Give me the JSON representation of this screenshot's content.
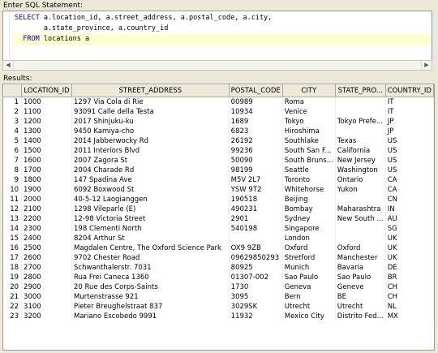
{
  "editor": {
    "label": "Enter SQL Statement:",
    "lines": [
      {
        "kw": "SELECT",
        "text": " a.location_id, a.street_address, a.postal_code, a.city,"
      },
      {
        "kw": "",
        "text": "       a.state_province, a.country_id"
      },
      {
        "kw": "  FROM",
        "text": " locations a"
      }
    ]
  },
  "results": {
    "label": "Results:",
    "columns": [
      "",
      "LOCATION_ID",
      "STREET_ADDRESS",
      "POSTAL_CODE",
      "CITY",
      "STATE_PRO...",
      "COUNTRY_ID"
    ],
    "rows": [
      [
        "1",
        "1000",
        "1297 Via Cola di Rie",
        "00989",
        "Roma",
        "",
        "IT"
      ],
      [
        "2",
        "1100",
        "93091 Calle della Testa",
        "10934",
        "Venice",
        "",
        "IT"
      ],
      [
        "3",
        "1200",
        "2017 Shinjuku-ku",
        "1689",
        "Tokyo",
        "Tokyo Prefe...",
        "JP"
      ],
      [
        "4",
        "1300",
        "9450 Kamiya-cho",
        "6823",
        "Hiroshima",
        "",
        "JP"
      ],
      [
        "5",
        "1400",
        "2014 Jabberwocky Rd",
        "26192",
        "Southlake",
        "Texas",
        "US"
      ],
      [
        "6",
        "1500",
        "2011 Interiors Blvd",
        "99236",
        "South San F...",
        "California",
        "US"
      ],
      [
        "7",
        "1600",
        "2007 Zagora St",
        "50090",
        "South Bruns...",
        "New Jersey",
        "US"
      ],
      [
        "8",
        "1700",
        "2004 Charade Rd",
        "98199",
        "Seattle",
        "Washington",
        "US"
      ],
      [
        "9",
        "1800",
        "147 Spadina Ave",
        "M5V 2L7",
        "Toronto",
        "Ontario",
        "CA"
      ],
      [
        "10",
        "1900",
        "6092 Boxwood St",
        "YSW 9T2",
        "Whitehorse",
        "Yukon",
        "CA"
      ],
      [
        "11",
        "2000",
        "40-5-12 Laogianggen",
        "190518",
        "Beijing",
        "",
        "CN"
      ],
      [
        "12",
        "2100",
        "1298 Vileparle (E)",
        "490231",
        "Bombay",
        "Maharashtra",
        "IN"
      ],
      [
        "13",
        "2200",
        "12-98 Victoria Street",
        "2901",
        "Sydney",
        "New South ...",
        "AU"
      ],
      [
        "14",
        "2300",
        "198 Clementi North",
        "540198",
        "Singapore",
        "",
        "SG"
      ],
      [
        "15",
        "2400",
        "8204 Arthur St",
        "",
        "London",
        "",
        "UK"
      ],
      [
        "16",
        "2500",
        "Magdalen Centre, The Oxford Science Park",
        "OX9 9ZB",
        "Oxford",
        "Oxford",
        "UK"
      ],
      [
        "17",
        "2600",
        "9702 Chester Road",
        "09629850293",
        "Stretford",
        "Manchester",
        "UK"
      ],
      [
        "18",
        "2700",
        "Schwanthalerstr. 7031",
        "80925",
        "Munich",
        "Bavaria",
        "DE"
      ],
      [
        "19",
        "2800",
        "Rua Frei Caneca 1360",
        "01307-002",
        "Sao Paulo",
        "Sao Paulo",
        "BR"
      ],
      [
        "20",
        "2900",
        "20 Rue des Corps-Saints",
        "1730",
        "Geneva",
        "Geneve",
        "CH"
      ],
      [
        "21",
        "3000",
        "Murtenstrasse 921",
        "3095",
        "Bern",
        "BE",
        "CH"
      ],
      [
        "22",
        "3100",
        "Pieter Breughelstraat 837",
        "3029SK",
        "Utrecht",
        "Utrecht",
        "NL"
      ],
      [
        "23",
        "3200",
        "Mariano Escobedo 9991",
        "11932",
        "Mexico City",
        "Distrito Fed...",
        "MX"
      ]
    ]
  }
}
